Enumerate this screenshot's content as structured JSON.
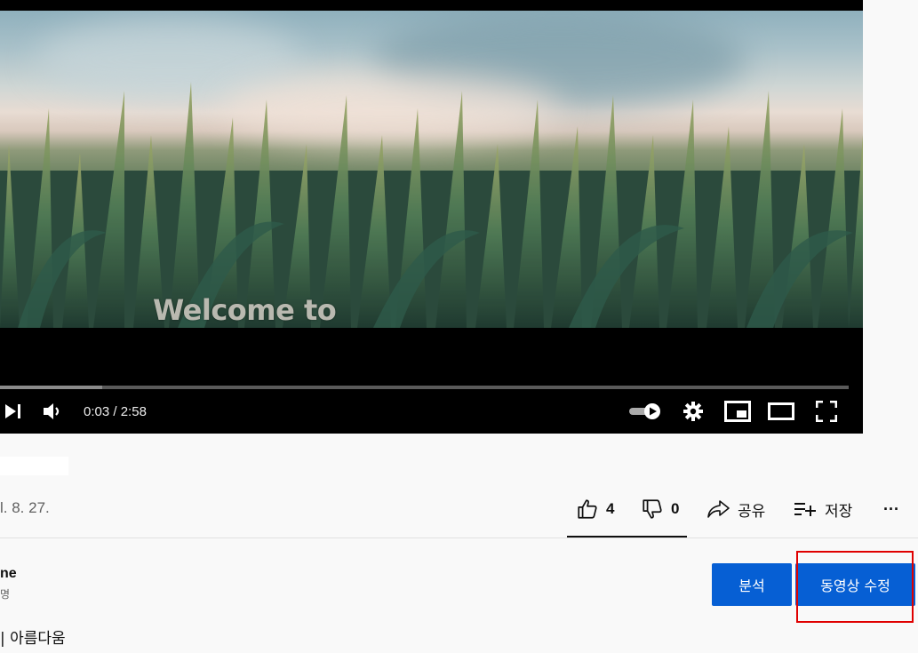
{
  "player": {
    "caption": "Welcome to",
    "time_current": "0:03",
    "time_separator": " / ",
    "time_total": "2:58",
    "progress": 0.12,
    "icons": [
      "next-icon",
      "volume-icon",
      "autoplay-toggle-icon",
      "settings-gear-icon",
      "miniplayer-icon",
      "theater-mode-icon",
      "fullscreen-icon"
    ]
  },
  "video": {
    "date": "l. 8. 27."
  },
  "actions": {
    "like_count": "4",
    "dislike_count": "0",
    "share_label": "공유",
    "save_label": "저장",
    "more_label": "···"
  },
  "channel": {
    "name": "ne",
    "sub": "명"
  },
  "description": {
    "text": "| 아름다움"
  },
  "buttons": {
    "analytics_label": "분석",
    "edit_video_label": "동영상 수정"
  },
  "colors": {
    "accent": "#065fd4",
    "highlight": "#e00000"
  }
}
